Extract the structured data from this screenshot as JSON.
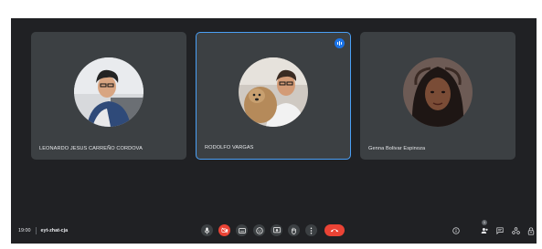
{
  "participants": [
    {
      "name": "LEONARDO JESUS CARREÑO CORDOVA",
      "speaking": false
    },
    {
      "name": "RODOLFO VARGAS",
      "speaking": true
    },
    {
      "name": "Genna Bolivar Espinoza",
      "speaking": false
    }
  ],
  "meeting": {
    "time": "19:00",
    "code": "eyt-zhat-cja"
  },
  "controls": [
    {
      "name": "microphone-button",
      "icon": "mic-icon",
      "state": "on"
    },
    {
      "name": "camera-button",
      "icon": "camera-off-icon",
      "state": "off"
    },
    {
      "name": "captions-button",
      "icon": "captions-icon"
    },
    {
      "name": "emoji-button",
      "icon": "emoji-icon"
    },
    {
      "name": "present-button",
      "icon": "present-screen-icon"
    },
    {
      "name": "raise-hand-button",
      "icon": "hand-icon"
    },
    {
      "name": "more-options-button",
      "icon": "more-vert-icon"
    },
    {
      "name": "leave-call-button",
      "icon": "hangup-icon"
    }
  ],
  "side_controls": {
    "participants_count": "1"
  },
  "colors": {
    "background": "#202124",
    "tile": "#3c4043",
    "accent": "#1a73e8",
    "danger": "#ea4335"
  }
}
